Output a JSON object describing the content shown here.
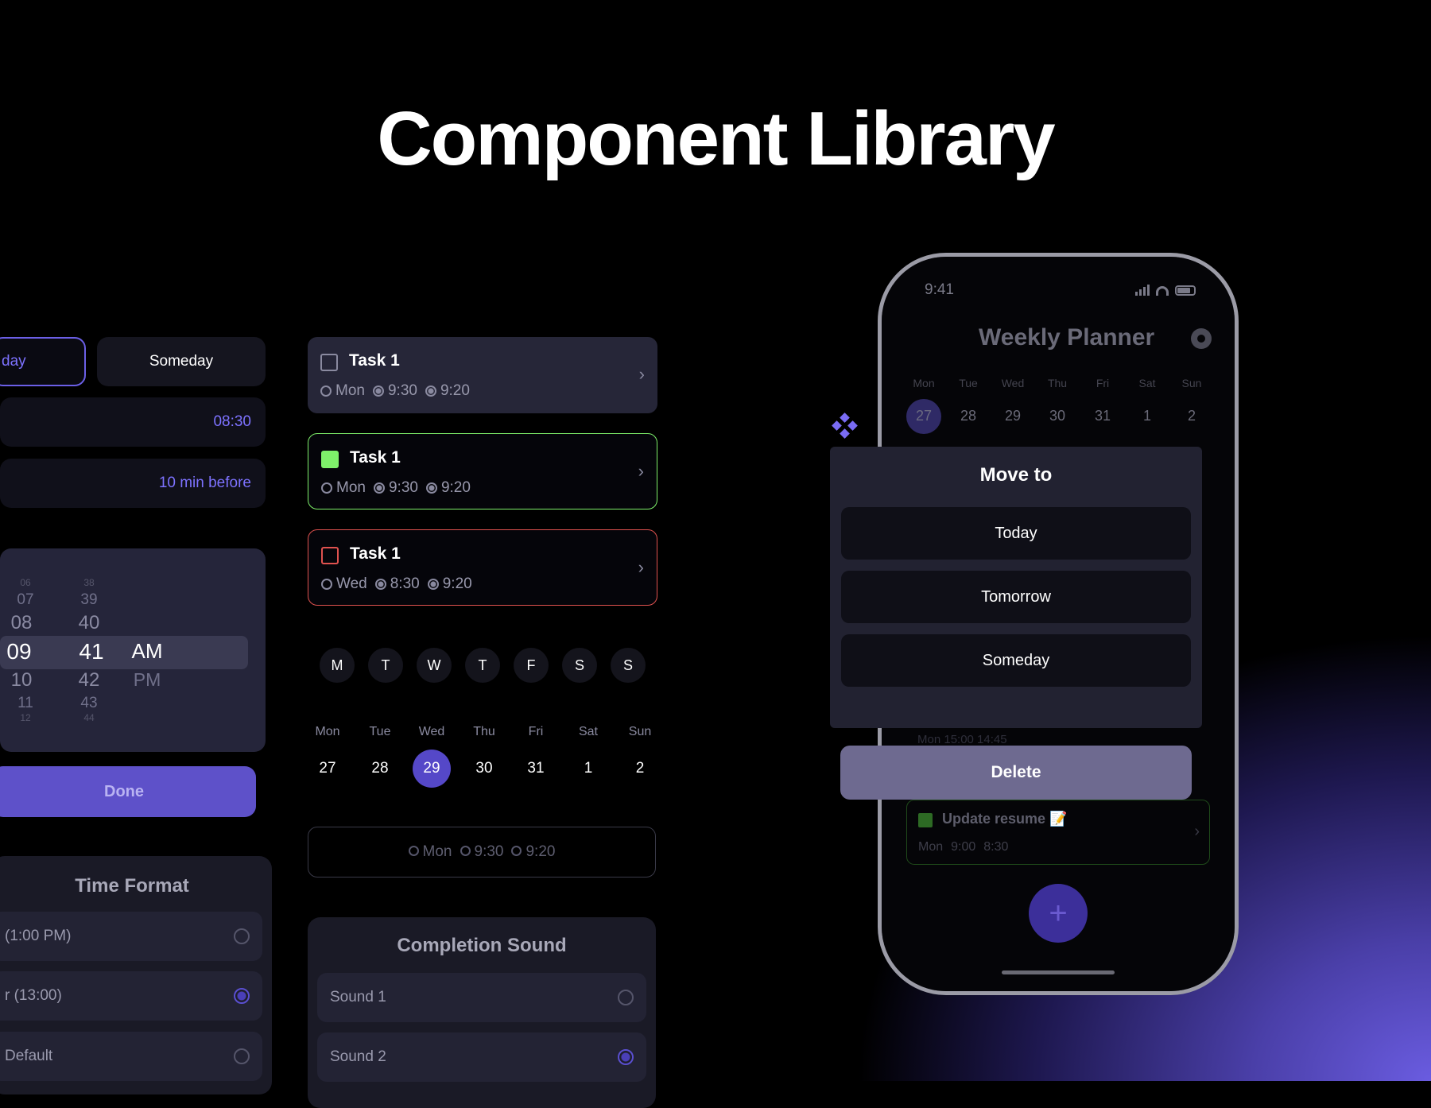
{
  "hero": {
    "title": "Component Library"
  },
  "left": {
    "segment": {
      "active_partial": "day",
      "someday": "Someday"
    },
    "time_value": "08:30",
    "reminder_value": "10 min before",
    "picker": {
      "hours": [
        "06",
        "07",
        "08",
        "09",
        "10",
        "11",
        "12"
      ],
      "minutes": [
        "38",
        "39",
        "40",
        "41",
        "42",
        "43",
        "44"
      ],
      "ampm": [
        "AM",
        "PM"
      ]
    },
    "done_label": "Done",
    "time_format": {
      "title": "Time Format",
      "options": [
        "(1:00 PM)",
        "r (13:00)",
        "Default"
      ]
    }
  },
  "tasks": [
    {
      "name": "Task 1",
      "day": "Mon",
      "time": "9:30",
      "remind": "9:20",
      "state": "default"
    },
    {
      "name": "Task 1",
      "day": "Mon",
      "time": "9:30",
      "remind": "9:20",
      "state": "done"
    },
    {
      "name": "Task 1",
      "day": "Wed",
      "time": "8:30",
      "remind": "9:20",
      "state": "overdue"
    }
  ],
  "weekday_circles": [
    "M",
    "T",
    "W",
    "T",
    "F",
    "S",
    "S"
  ],
  "week": {
    "labels": [
      "Mon",
      "Tue",
      "Wed",
      "Thu",
      "Fri",
      "Sat",
      "Sun"
    ],
    "dates": [
      "27",
      "28",
      "29",
      "30",
      "31",
      "1",
      "2"
    ],
    "selected_index": 2
  },
  "summary": {
    "day": "Mon",
    "time": "9:30",
    "remind": "9:20"
  },
  "completion_sound": {
    "title": "Completion Sound",
    "options": [
      "Sound 1",
      "Sound 2"
    ],
    "selected_index": 1
  },
  "phone": {
    "status_time": "9:41",
    "app_title": "Weekly Planner",
    "week_labels": [
      "Mon",
      "Tue",
      "Wed",
      "Thu",
      "Fri",
      "Sat",
      "Sun"
    ],
    "week_dates": [
      "27",
      "28",
      "29",
      "30",
      "31",
      "1",
      "2"
    ],
    "modal": {
      "title": "Move to",
      "options": [
        "Today",
        "Tomorrow",
        "Someday"
      ]
    },
    "delete_label": "Delete",
    "bg_task_meta": "Mon  15:00  14:45",
    "task": {
      "name": "Update resume 📝",
      "day": "Mon",
      "time": "9:00",
      "remind": "8:30"
    },
    "fab_icon": "plus-icon"
  },
  "colors": {
    "accent": "#6b5fe6",
    "done_green": "#7ef06a",
    "overdue_red": "#e0524f",
    "delete_gray": "#6e6a90"
  }
}
